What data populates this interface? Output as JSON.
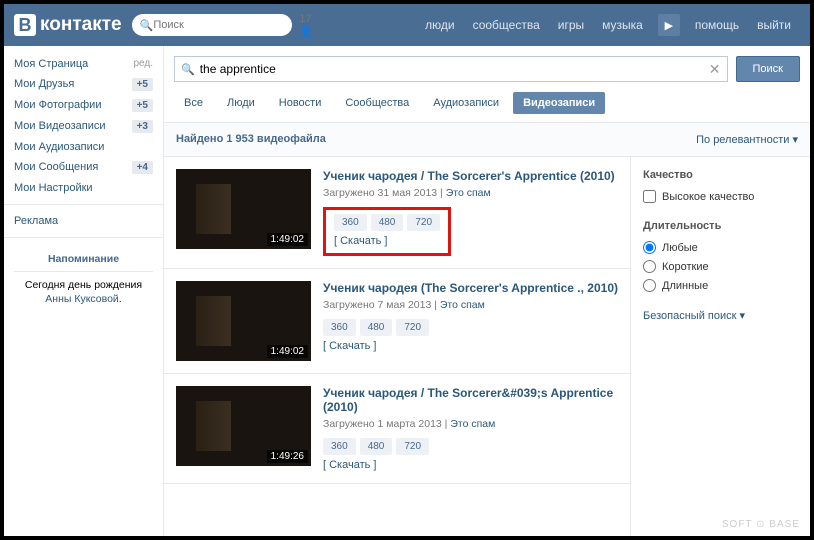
{
  "header": {
    "logo_text": "контакте",
    "logo_letter": "В",
    "search_placeholder": "Поиск",
    "notif_count": "17",
    "nav": [
      "люди",
      "сообщества",
      "игры",
      "музыка"
    ],
    "nav_right": [
      "помощь",
      "выйти"
    ]
  },
  "sidebar": {
    "items": [
      {
        "label": "Моя Страница",
        "extra": "ред."
      },
      {
        "label": "Мои Друзья",
        "badge": "+5"
      },
      {
        "label": "Мои Фотографии",
        "badge": "+5"
      },
      {
        "label": "Мои Видеозаписи",
        "badge": "+3"
      },
      {
        "label": "Мои Аудиозаписи"
      },
      {
        "label": "Мои Сообщения",
        "badge": "+4"
      },
      {
        "label": "Мои Настройки"
      }
    ],
    "ad_label": "Реклама",
    "reminder": {
      "title": "Напоминание",
      "text1": "Сегодня ",
      "text2": "день рождения ",
      "link": "Анны Куксовой",
      "text3": "."
    }
  },
  "search": {
    "value": "the apprentice",
    "button": "Поиск"
  },
  "tabs": [
    "Все",
    "Люди",
    "Новости",
    "Сообщества",
    "Аудиозаписи",
    "Видеозаписи"
  ],
  "active_tab": 5,
  "results": {
    "count_text": "Найдено 1 953 видеофайла",
    "sort": "По релевантности"
  },
  "videos": [
    {
      "title": "Ученик чародея / The Sorcerer's Apprentice (2010)",
      "meta": "Загружено 31 мая 2013",
      "spam": "Это спам",
      "qualities": [
        "360",
        "480",
        "720"
      ],
      "download": "[ Скачать ]",
      "duration": "1:49:02",
      "highlighted": true
    },
    {
      "title": "Ученик чародея (The Sorcerer's Apprentice ., 2010)",
      "meta": "Загружено 7 мая 2013",
      "spam": "Это спам",
      "qualities": [
        "360",
        "480",
        "720"
      ],
      "download": "[ Скачать ]",
      "duration": "1:49:02"
    },
    {
      "title": "Ученик чародея / The Sorcerer&#039;s Apprentice (2010)",
      "meta": "Загружено 1 марта 2013",
      "spam": "Это спам",
      "qualities": [
        "360",
        "480",
        "720"
      ],
      "download": "[ Скачать ]",
      "duration": "1:49:26"
    }
  ],
  "filters": {
    "quality_title": "Качество",
    "quality_hq": "Высокое качество",
    "duration_title": "Длительность",
    "duration_opts": [
      "Любые",
      "Короткие",
      "Длинные"
    ],
    "safe": "Безопасный поиск"
  },
  "watermark": "SOFT ⊙ BASE"
}
